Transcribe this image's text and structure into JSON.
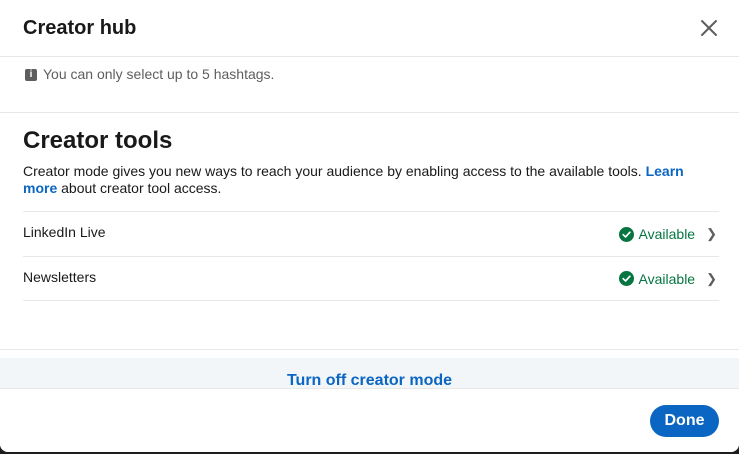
{
  "header": {
    "title": "Creator hub",
    "close_icon": "close-icon"
  },
  "info": {
    "icon": "info-icon",
    "text": "You can only select up to 5 hashtags."
  },
  "creator_tools": {
    "title": "Creator tools",
    "description": "Creator mode gives you new ways to reach your audience by enabling access to the available tools.",
    "learn_more": "Learn more",
    "description_suffix": "about creator tool access.",
    "items": [
      {
        "name": "LinkedIn Live",
        "status": "Available"
      },
      {
        "name": "Newsletters",
        "status": "Available"
      }
    ]
  },
  "turn_off_label": "Turn off creator mode",
  "footer": {
    "done_label": "Done"
  },
  "colors": {
    "accent": "#0a66c2",
    "available": "#057642",
    "muted": "#5e5e5e"
  }
}
